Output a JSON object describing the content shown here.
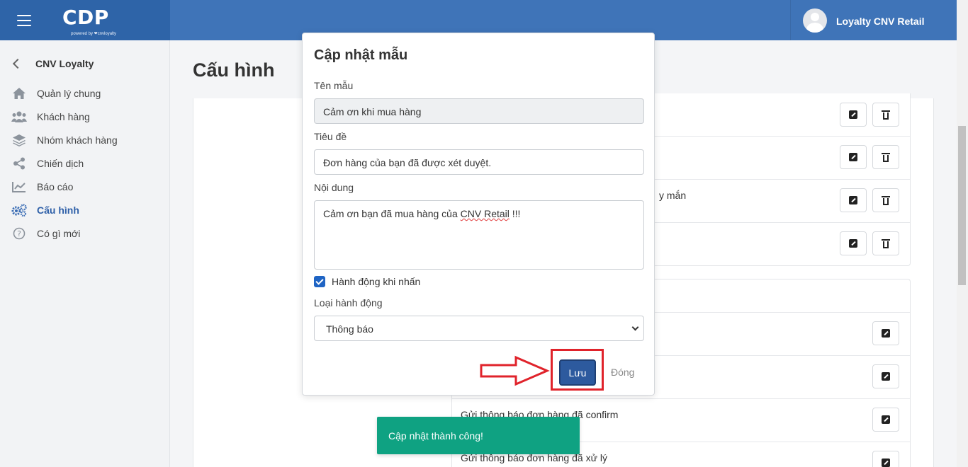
{
  "topbar": {
    "logo_text": "CDP",
    "logo_subtitle": "powered by ❤cnvloyalty",
    "user_name": "Loyalty CNV Retail",
    "colors": {
      "primary": "#3f74b8",
      "brand": "#2e64a8"
    }
  },
  "sidebar": {
    "back_title": "CNV Loyalty",
    "items": [
      {
        "label": "Quản lý chung",
        "icon": "home-icon"
      },
      {
        "label": "Khách hàng",
        "icon": "users-icon"
      },
      {
        "label": "Nhóm khách hàng",
        "icon": "layers-icon"
      },
      {
        "label": "Chiến dịch",
        "icon": "share-icon"
      },
      {
        "label": "Báo cáo",
        "icon": "chart-icon"
      },
      {
        "label": "Cấu hình",
        "icon": "gears-icon",
        "active": true
      },
      {
        "label": "Có gì mới",
        "icon": "question-icon"
      }
    ]
  },
  "main": {
    "page_title": "Cấu hình",
    "list1_fragment": "y mắn",
    "list2_rows": [
      "Gửi thông báo đơn hàng đã confirm",
      "Gửi thông báo đơn hàng đã xử lý"
    ]
  },
  "modal": {
    "title": "Cập nhật mẫu",
    "name_label": "Tên mẫu",
    "name_value": "Cảm ơn khi mua hàng",
    "subject_label": "Tiêu đề",
    "subject_value": "Đơn hàng của bạn đã được xét duyệt.",
    "content_label": "Nội dung",
    "content_prefix": "Cảm ơn bạn đã mua hàng của ",
    "content_brand": "CNV Retail",
    "content_suffix": " !!!",
    "checkbox_label": "Hành động khi nhấn",
    "checkbox_checked": true,
    "action_type_label": "Loại hành động",
    "action_type_value": "Thông báo",
    "save_label": "Lưu",
    "close_label": "Đóng"
  },
  "toast": {
    "message": "Cập nhật thành công!",
    "color": "#0fa282"
  }
}
